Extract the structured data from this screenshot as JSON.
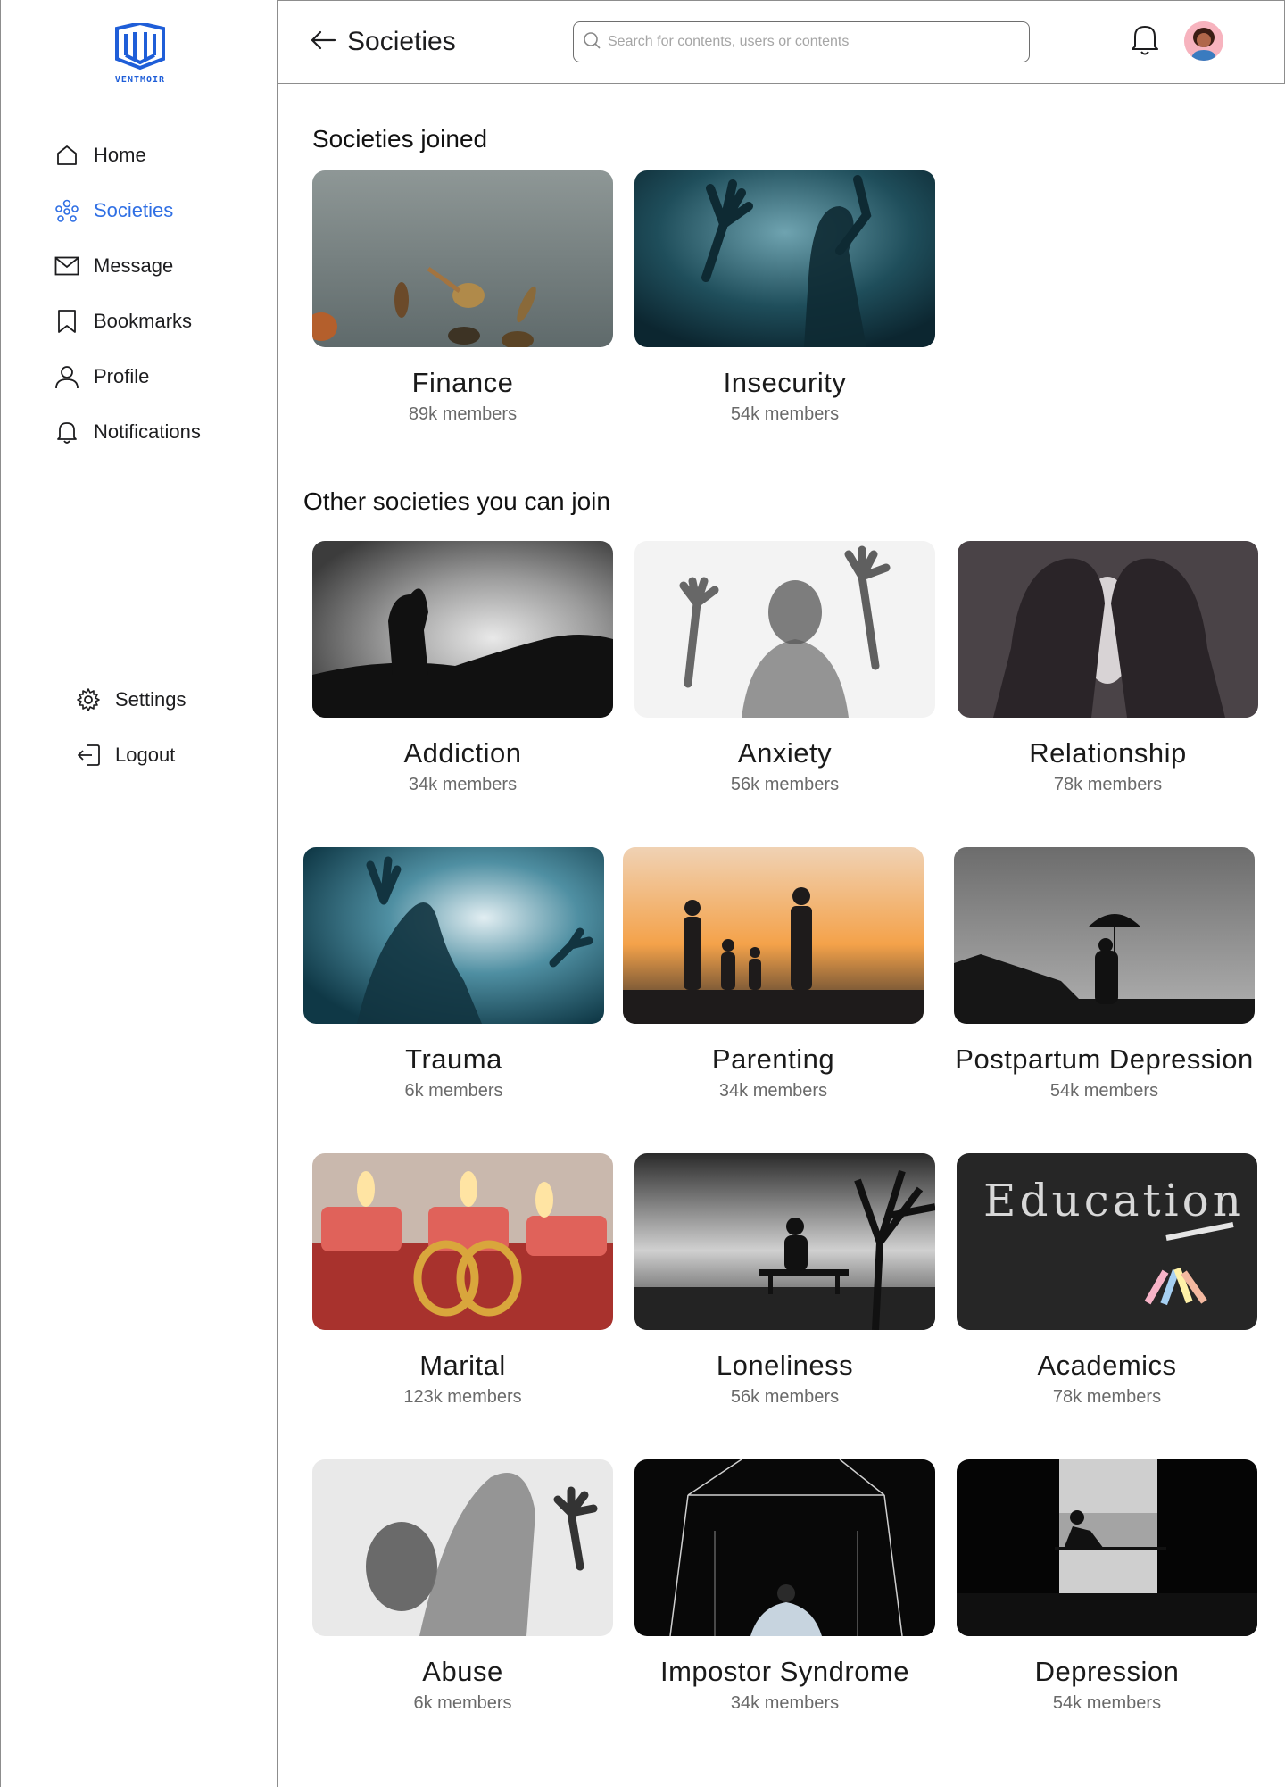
{
  "app": {
    "name": "VENTMOIR"
  },
  "sidebar": {
    "items": [
      {
        "label": "Home",
        "icon": "home-icon"
      },
      {
        "label": "Societies",
        "icon": "societies-icon"
      },
      {
        "label": "Message",
        "icon": "mail-icon"
      },
      {
        "label": "Bookmarks",
        "icon": "bookmark-icon"
      },
      {
        "label": "Profile",
        "icon": "user-icon"
      },
      {
        "label": "Notifications",
        "icon": "bell-icon"
      }
    ],
    "bottom": [
      {
        "label": "Settings",
        "icon": "gear-icon"
      },
      {
        "label": "Logout",
        "icon": "logout-icon"
      }
    ],
    "active_color": "#2f6fe4"
  },
  "header": {
    "title": "Societies",
    "search_placeholder": "Search for contents, users or contents"
  },
  "joined": {
    "title": "Societies joined",
    "cards": [
      {
        "name": "Finance",
        "members": "89k members",
        "image": "falling-coins"
      },
      {
        "name": "Insecurity",
        "members": "54k members",
        "image": "silhouette-behind-plastic"
      }
    ]
  },
  "others": {
    "title": "Other societies you can join",
    "cards": [
      {
        "name": "Addiction",
        "members": "34k members",
        "image": "smoking-silhouette"
      },
      {
        "name": "Anxiety",
        "members": "56k members",
        "image": "hands-against-glass"
      },
      {
        "name": "Relationship",
        "members": "78k members",
        "image": "kissing-silhouette"
      },
      {
        "name": "Trauma",
        "members": "6k members",
        "image": "figure-behind-sheet"
      },
      {
        "name": "Parenting",
        "members": "34k members",
        "image": "family-sunset"
      },
      {
        "name": "Postpartum Depression",
        "members": "54k members",
        "image": "umbrella-storm"
      },
      {
        "name": "Marital",
        "members": "123k members",
        "image": "rings-candles"
      },
      {
        "name": "Loneliness",
        "members": "56k members",
        "image": "bench-tree"
      },
      {
        "name": "Academics",
        "members": "78k members",
        "image": "chalkboard-education"
      },
      {
        "name": "Abuse",
        "members": "6k members",
        "image": "blurred-figure"
      },
      {
        "name": "Impostor Syndrome",
        "members": "34k members",
        "image": "dark-room-figure"
      },
      {
        "name": "Depression",
        "members": "54k members",
        "image": "window-silhouette"
      }
    ]
  }
}
